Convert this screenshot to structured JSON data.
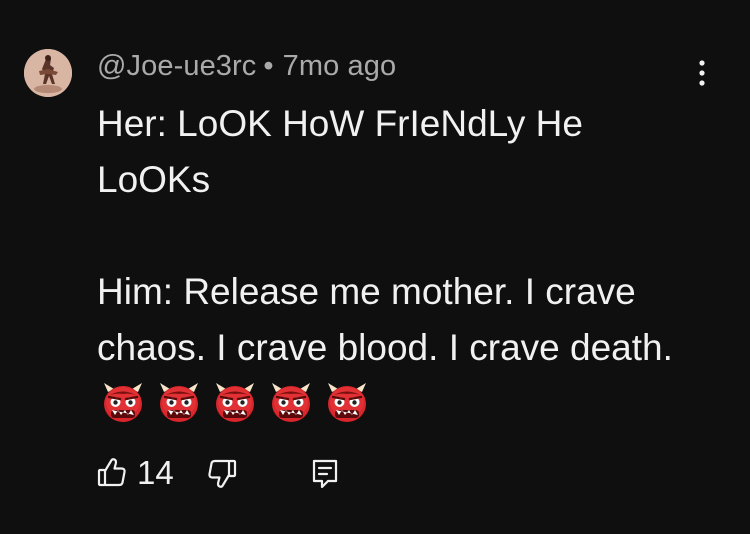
{
  "comment": {
    "author": "@Joe-ue3rc",
    "separator": "•",
    "time": "7mo ago",
    "lines": [
      "Her: LoOK HoW FrIeNdLy He LoOKs",
      "Him: Release me mother. I crave chaos. I crave blood. I crave death."
    ],
    "emoji_name": "ogre-emoji",
    "emoji_count": 5
  },
  "actions": {
    "like_icon": "thumbs-up-icon",
    "like_count": "14",
    "dislike_icon": "thumbs-down-icon",
    "reply_icon": "reply-comment-icon",
    "more_icon": "more-vertical-icon"
  },
  "colors": {
    "background": "#0f0f0f",
    "text": "#f1f1f1",
    "meta_text": "#aaaaaa",
    "ogre_red": "#d8262c"
  }
}
